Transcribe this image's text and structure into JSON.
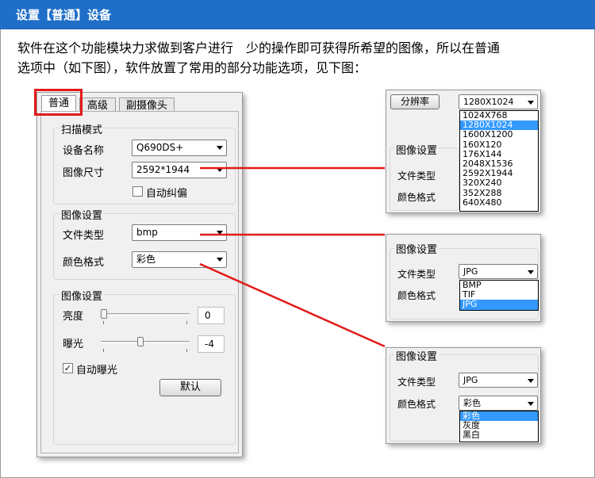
{
  "header": {
    "title": "设置【普通】设备"
  },
  "intro": {
    "line1": "软件在这个功能模块力求做到客户进行　少的操作即可获得所希望的图像，所以在普通",
    "line2": "选项中（如下图），软件放置了常用的部分功能选项，见下图："
  },
  "main_window": {
    "tabs": [
      "普通",
      "高级",
      "副摄像头"
    ],
    "scan_group": {
      "title": "扫描模式",
      "device_label": "设备名称",
      "device_value": "Q690DS+",
      "size_label": "图像尺寸",
      "size_value": "2592*1944",
      "auto_deskew_label": "自动纠偏",
      "auto_deskew_checked": false
    },
    "image_group": {
      "title": "图像设置",
      "file_type_label": "文件类型",
      "file_type_value": "bmp",
      "color_label": "颜色格式",
      "color_value": "彩色"
    },
    "adjust_group": {
      "title": "图像设置",
      "brightness_label": "亮度",
      "brightness_value": "0",
      "brightness_level": 0.0,
      "exposure_label": "曝光",
      "exposure_value": "-4",
      "exposure_level": 0.45,
      "auto_exposure_label": "自动曝光",
      "auto_exposure_checked": true,
      "default_button": "默认"
    }
  },
  "resolution_panel": {
    "button": "分辨率",
    "selected": "1280X1024",
    "options": [
      "1024X768",
      "1280X1024",
      "1600X1200",
      "160X120",
      "176X144",
      "2048X1536",
      "2592X1944",
      "320X240",
      "352X288",
      "640X480"
    ],
    "highlighted_index": 1,
    "group_title": "图像设置",
    "file_type_label": "文件类型",
    "color_label": "颜色格式"
  },
  "filetype_panel": {
    "group_title": "图像设置",
    "file_type_label": "文件类型",
    "file_type_value": "JPG",
    "options": [
      "BMP",
      "TIF",
      "JPG"
    ],
    "highlighted_index": 2,
    "color_label": "颜色格式"
  },
  "color_panel": {
    "group_title": "图像设置",
    "file_type_label": "文件类型",
    "file_type_value": "JPG",
    "color_label": "颜色格式",
    "color_value": "彩色",
    "options": [
      "彩色",
      "灰度",
      "黑白"
    ],
    "highlighted_index": 0
  },
  "colors": {
    "header_bg": "#1f6fc8",
    "annotation_red": "#e21a1a",
    "highlight": "#3399ff"
  }
}
